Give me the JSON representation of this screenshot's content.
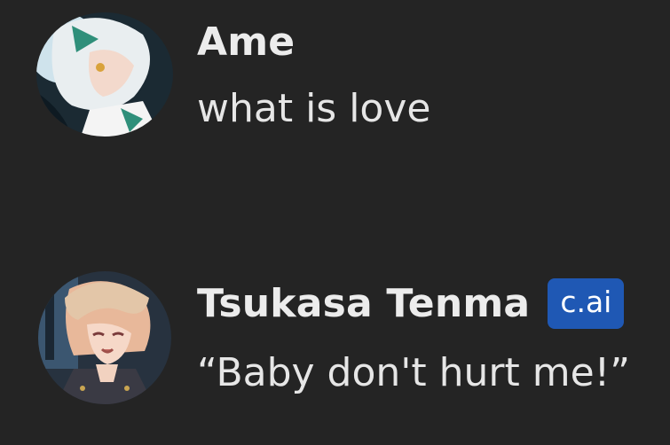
{
  "theme": {
    "background": "#242424",
    "text": "#ececec",
    "badge_bg": "#1f58b4"
  },
  "messages": [
    {
      "author": "Ame",
      "avatar": "anime-avatar-white-hair",
      "text": "what is love"
    },
    {
      "author": "Tsukasa Tenma",
      "badge": "c.ai",
      "avatar": "anime-avatar-blond-boy",
      "text": "“Baby don't hurt me!”"
    }
  ]
}
